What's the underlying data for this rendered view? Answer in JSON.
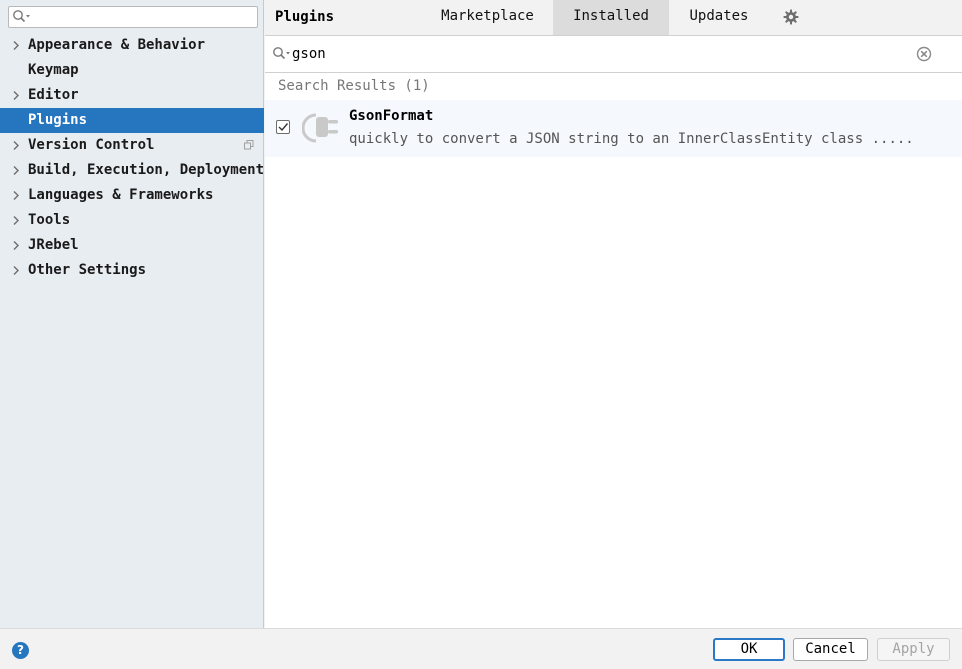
{
  "sidebar": {
    "search": {
      "value": "",
      "icon": "search-icon"
    },
    "items": [
      {
        "label": "Appearance & Behavior",
        "expandable": true
      },
      {
        "label": "Keymap",
        "expandable": false
      },
      {
        "label": "Editor",
        "expandable": true
      },
      {
        "label": "Plugins",
        "expandable": false,
        "selected": true
      },
      {
        "label": "Version Control",
        "expandable": true
      },
      {
        "label": "Build, Execution, Deployment",
        "expandable": true
      },
      {
        "label": "Languages & Frameworks",
        "expandable": true
      },
      {
        "label": "Tools",
        "expandable": true
      },
      {
        "label": "JRebel",
        "expandable": true
      },
      {
        "label": "Other Settings",
        "expandable": true
      }
    ]
  },
  "header": {
    "title": "Plugins",
    "tabs": [
      {
        "label": "Marketplace"
      },
      {
        "label": "Installed",
        "active": true
      },
      {
        "label": "Updates"
      }
    ],
    "settings_icon": "gear-icon"
  },
  "plugin_search": {
    "value": "gson",
    "icon": "search-icon",
    "clear_icon": "clear-icon"
  },
  "results": {
    "heading": "Search Results (1)",
    "plugins": [
      {
        "name": "GsonFormat",
        "description": "quickly to convert a JSON string to an InnerClassEntity class .....",
        "enabled": true,
        "icon": "plugin-icon"
      }
    ]
  },
  "footer": {
    "help_label": "?",
    "ok_label": "OK",
    "cancel_label": "Cancel",
    "apply_label": "Apply"
  },
  "colors": {
    "selection": "#2675bf",
    "sidebar_bg": "#e8edf2",
    "ok_border": "#2a78c6"
  }
}
